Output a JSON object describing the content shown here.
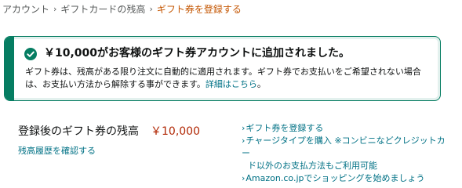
{
  "breadcrumb": {
    "items": [
      "アカウント",
      "ギフトカードの残高"
    ],
    "separator": "›",
    "current": "ギフト券を登録する"
  },
  "alert": {
    "heading": "￥10,000がお客様のギフト券アカウントに追加されました。",
    "body_text_line1": "ギフト券は、残高がある限り注文に自動的に適用されます。ギフト券でお支払いをご希望されない場合",
    "body_text_line2": "は、お支払い方法から解除する事ができます。",
    "details_link": "詳細はこちら",
    "details_suffix": "。",
    "icon": "check-circle-icon",
    "accent_color": "#067d62"
  },
  "balance": {
    "label": "登録後のギフト券の残高",
    "amount": "￥10,000",
    "amount_color": "#b12704",
    "history_link": "残高履歴を確認する"
  },
  "side_links": {
    "chevron": "›",
    "register": "ギフト券を登録する",
    "charge_line1": "チャージタイプを購入 ※コンビニなどクレジットカー",
    "charge_line2": "ド以外のお支払方法もご利用可能",
    "shop": "Amazon.co.jpでショッピングを始めましょう"
  },
  "colors": {
    "link": "#007185",
    "breadcrumb_current": "#c45500",
    "text": "#0f1111"
  }
}
